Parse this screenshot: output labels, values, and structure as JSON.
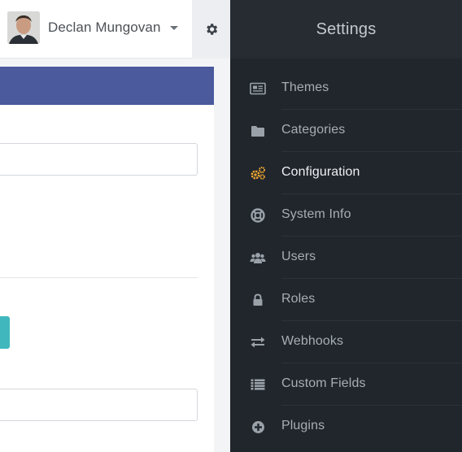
{
  "header": {
    "user_name": "Declan Mungovan",
    "avatar_icon": "user-avatar",
    "settings_icon": "gear-icon"
  },
  "sidebar": {
    "title": "Settings",
    "active_color": "#f0a830",
    "items": [
      {
        "label": "Themes",
        "icon": "newspaper-icon",
        "active": false
      },
      {
        "label": "Categories",
        "icon": "folder-icon",
        "active": false
      },
      {
        "label": "Configuration",
        "icon": "cogs-icon",
        "active": true
      },
      {
        "label": "System Info",
        "icon": "life-ring-icon",
        "active": false
      },
      {
        "label": "Users",
        "icon": "users-icon",
        "active": false
      },
      {
        "label": "Roles",
        "icon": "lock-icon",
        "active": false
      },
      {
        "label": "Webhooks",
        "icon": "exchange-icon",
        "active": false
      },
      {
        "label": "Custom Fields",
        "icon": "list-icon",
        "active": false
      },
      {
        "label": "Plugins",
        "icon": "plus-circle-icon",
        "active": false
      }
    ]
  },
  "colors": {
    "panel_header": "#4a5a9d",
    "teal_button": "#3fb7bd",
    "sidebar_bg": "#21262d"
  }
}
